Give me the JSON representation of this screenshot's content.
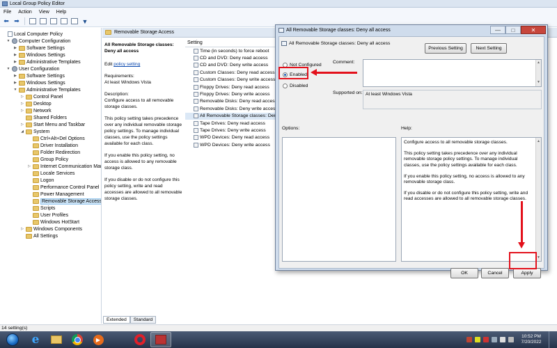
{
  "window": {
    "title": "Local Group Policy Editor"
  },
  "menu": [
    "File",
    "Action",
    "View",
    "Help"
  ],
  "tree": {
    "items": [
      {
        "label": "Local Computer Policy",
        "icon": "doc",
        "level": 0,
        "exp": ""
      },
      {
        "label": "Computer Configuration",
        "icon": "gear",
        "level": 1,
        "exp": "▼"
      },
      {
        "label": "Software Settings",
        "icon": "folder",
        "level": 2,
        "exp": "▶"
      },
      {
        "label": "Windows Settings",
        "icon": "folder",
        "level": 2,
        "exp": "▶"
      },
      {
        "label": "Administrative Templates",
        "icon": "folder",
        "level": 2,
        "exp": "▶"
      },
      {
        "label": "User Configuration",
        "icon": "gear",
        "level": 1,
        "exp": "▼"
      },
      {
        "label": "Software Settings",
        "icon": "folder",
        "level": 2,
        "exp": "▶"
      },
      {
        "label": "Windows Settings",
        "icon": "folder",
        "level": 2,
        "exp": "▶"
      },
      {
        "label": "Administrative Templates",
        "icon": "folder",
        "level": 2,
        "exp": "▼"
      },
      {
        "label": "Control Panel",
        "icon": "folder",
        "level": 3,
        "exp": "▷"
      },
      {
        "label": "Desktop",
        "icon": "folder",
        "level": 3,
        "exp": "▷"
      },
      {
        "label": "Network",
        "icon": "folder",
        "level": 3,
        "exp": "▷"
      },
      {
        "label": "Shared Folders",
        "icon": "folder",
        "level": 3,
        "exp": ""
      },
      {
        "label": "Start Menu and Taskbar",
        "icon": "folder",
        "level": 3,
        "exp": "▷"
      },
      {
        "label": "System",
        "icon": "folder",
        "level": 3,
        "exp": "◢"
      },
      {
        "label": "Ctrl+Alt+Del Options",
        "icon": "folder",
        "level": 4,
        "exp": ""
      },
      {
        "label": "Driver Installation",
        "icon": "folder",
        "level": 4,
        "exp": ""
      },
      {
        "label": "Folder Redirection",
        "icon": "folder",
        "level": 4,
        "exp": ""
      },
      {
        "label": "Group Policy",
        "icon": "folder",
        "level": 4,
        "exp": ""
      },
      {
        "label": "Internet Communication Man",
        "icon": "folder",
        "level": 4,
        "exp": "▷"
      },
      {
        "label": "Locale Services",
        "icon": "folder",
        "level": 4,
        "exp": ""
      },
      {
        "label": "Logon",
        "icon": "folder",
        "level": 4,
        "exp": ""
      },
      {
        "label": "Performance Control Panel",
        "icon": "folder",
        "level": 4,
        "exp": ""
      },
      {
        "label": "Power Management",
        "icon": "folder",
        "level": 4,
        "exp": ""
      },
      {
        "label": "Removable Storage Access",
        "icon": "folder",
        "level": 4,
        "exp": "",
        "selected": true
      },
      {
        "label": "Scripts",
        "icon": "folder",
        "level": 4,
        "exp": ""
      },
      {
        "label": "User Profiles",
        "icon": "folder",
        "level": 4,
        "exp": ""
      },
      {
        "label": "Windows HotStart",
        "icon": "folder",
        "level": 4,
        "exp": ""
      },
      {
        "label": "Windows Components",
        "icon": "folder",
        "level": 3,
        "exp": "▷"
      },
      {
        "label": "All Settings",
        "icon": "folder",
        "level": 3,
        "exp": ""
      }
    ]
  },
  "content": {
    "header": "Removable Storage Access",
    "description": {
      "title": "All Removable Storage classes: Deny all access",
      "edit_prefix": "Edit ",
      "edit_link": "policy setting",
      "requirements_label": "Requirements:",
      "requirements_value": "At least Windows Vista",
      "description_label": "Description:",
      "paragraphs": [
        "Configure access to all removable storage classes.",
        "This policy setting takes precedence over any individual removable storage policy settings. To manage individual classes, use the policy settings available for each class.",
        "If you enable this policy setting, no access is allowed to any removable storage class.",
        "If you disable or do not configure this policy setting, write and read accesses are allowed to all removable storage classes."
      ]
    },
    "settings_header": "Setting",
    "settings": [
      "Time (in seconds) to force reboot",
      "CD and DVD: Deny read access",
      "CD and DVD: Deny write access",
      "Custom Classes: Deny read access",
      "Custom Classes: Deny write access",
      "Floppy Drives: Deny read access",
      "Floppy Drives: Deny write access",
      "Removable Disks: Deny read access",
      "Removable Disks: Deny write access",
      "All Removable Storage classes: Deny all a",
      "Tape Drives: Deny read access",
      "Tape Drives: Deny write access",
      "WPD Devices: Deny read access",
      "WPD Devices: Deny write access"
    ],
    "selected_setting_index": 9
  },
  "tabs": [
    "Extended",
    "Standard"
  ],
  "status": "14 setting(s)",
  "dialog": {
    "title": "All Removable Storage classes: Deny all access",
    "setting_name": "All Removable Storage classes: Deny all access",
    "previous_label": "Previous Setting",
    "next_label": "Next Setting",
    "radio_not_configured": "Not Configured",
    "radio_enabled": "Enabled",
    "radio_disabled": "Disabled",
    "selected_radio": "Enabled",
    "comment_label": "Comment:",
    "supported_label": "Supported on:",
    "supported_value": "At least Windows Vista",
    "options_label": "Options:",
    "help_label": "Help:",
    "help_paragraphs": [
      "Configure access to all removable storage classes.",
      "This policy setting takes precedence over any individual removable storage policy settings. To manage individual classes, use the policy settings available for each class.",
      "If you enable this policy setting, no access is allowed to any removable storage class.",
      "If you disable or do not configure this policy setting, write and read accesses are allowed to all removable storage classes."
    ],
    "ok_label": "OK",
    "cancel_label": "Cancel",
    "apply_label": "Apply",
    "caption_minimize": "—",
    "caption_maximize": "□",
    "caption_close": "✕"
  },
  "taskbar": {
    "time": "10:52 PM",
    "date": "7/20/2022",
    "ie_glyph": "e",
    "media_glyph": "▶"
  },
  "annotation_color": "#e3101b"
}
